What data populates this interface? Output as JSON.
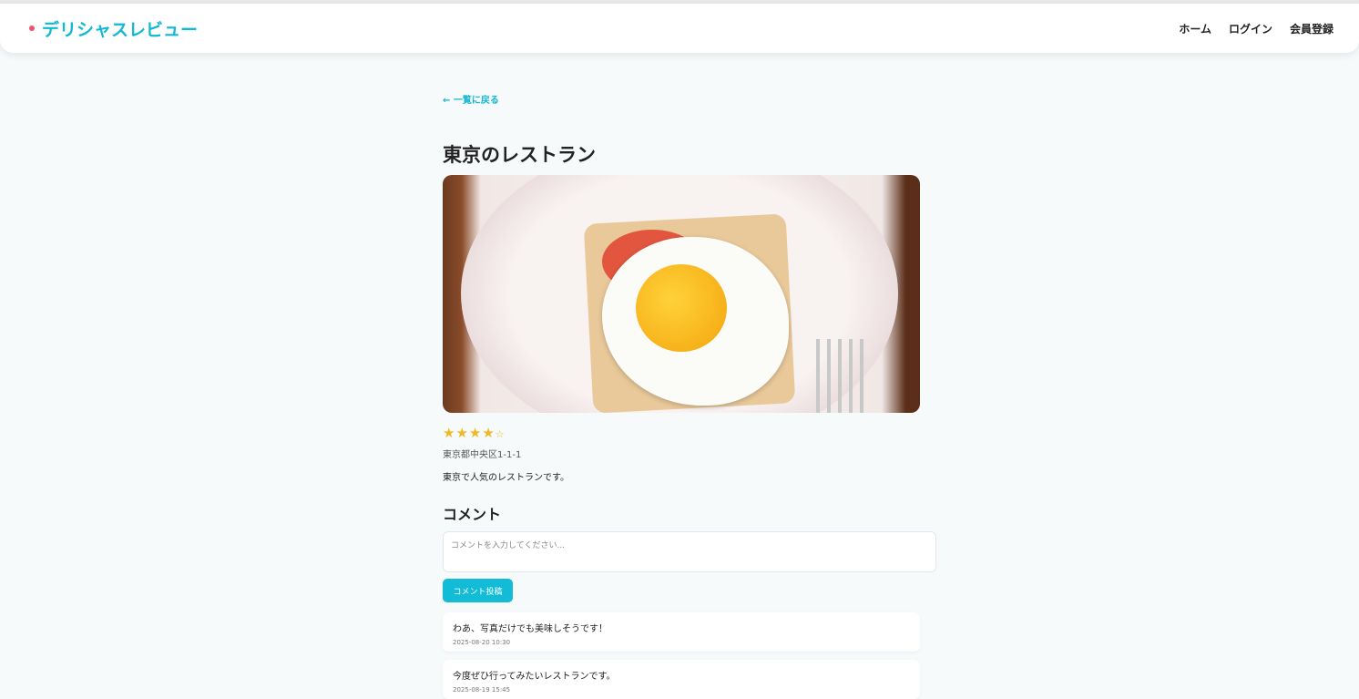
{
  "header": {
    "logo": "デリシャスレビュー",
    "nav": [
      "ホーム",
      "ログイン",
      "会員登録"
    ]
  },
  "back_link": "← 一覧に戻る",
  "restaurant": {
    "name": "東京のレストラン",
    "rating": 4,
    "rating_max": 5,
    "stars_filled": "★★★★",
    "stars_empty": "☆",
    "address": "東京都中央区1-1-1",
    "description": "東京で人気のレストランです。",
    "accent": "#12b8d4"
  },
  "comments_section": {
    "title": "コメント",
    "placeholder": "コメントを入力してください...",
    "submit": "コメント投稿",
    "items": [
      {
        "text": "わあ、写真だけでも美味しそうです！",
        "date": "2025-08-20 10:30"
      },
      {
        "text": "今度ぜひ行ってみたいレストランです。",
        "date": "2025-08-19 15:45"
      }
    ]
  }
}
